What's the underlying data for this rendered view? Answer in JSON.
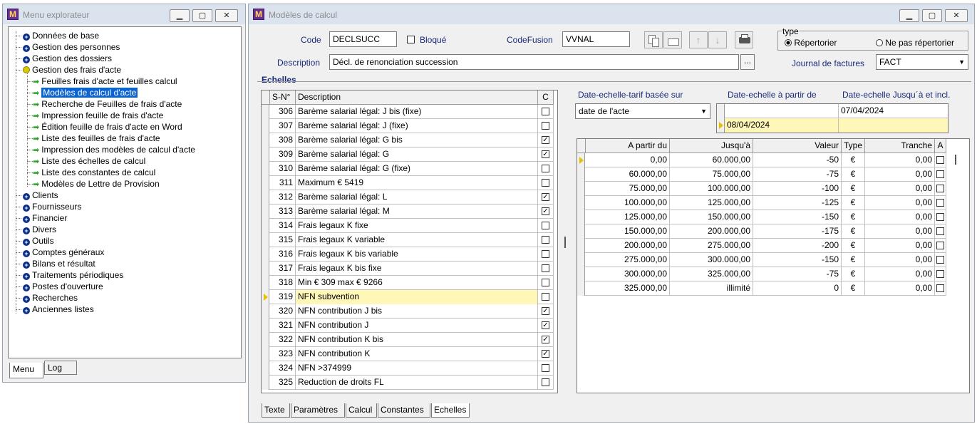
{
  "explorer": {
    "title": "Menu explorateur",
    "tree": [
      {
        "label": "Données de base",
        "type": "plus",
        "level": 0
      },
      {
        "label": "Gestion des personnes",
        "type": "plus",
        "level": 0
      },
      {
        "label": "Gestion des dossiers",
        "type": "plus",
        "level": 0
      },
      {
        "label": "Gestion des frais d'acte",
        "type": "minus",
        "level": 0
      },
      {
        "label": "Feuilles frais d'acte et feuilles calcul",
        "type": "arrow",
        "level": 1
      },
      {
        "label": "Modèles de calcul d'acte",
        "type": "arrow",
        "level": 1,
        "selected": true
      },
      {
        "label": "Recherche de Feuilles de frais d'acte",
        "type": "arrow",
        "level": 1
      },
      {
        "label": "Impression feuille de frais d'acte",
        "type": "arrow",
        "level": 1
      },
      {
        "label": "Édition feuille de frais d'acte en Word",
        "type": "arrow",
        "level": 1
      },
      {
        "label": "Liste des feuilles de frais d'acte",
        "type": "arrow",
        "level": 1
      },
      {
        "label": "Impression des modèles de calcul d'acte",
        "type": "arrow",
        "level": 1
      },
      {
        "label": "Liste des échelles de calcul",
        "type": "arrow",
        "level": 1
      },
      {
        "label": "Liste des constantes de calcul",
        "type": "arrow",
        "level": 1
      },
      {
        "label": "Modèles de Lettre de Provision",
        "type": "arrow",
        "level": 1
      },
      {
        "label": "Clients",
        "type": "plus",
        "level": 0
      },
      {
        "label": "Fournisseurs",
        "type": "plus",
        "level": 0
      },
      {
        "label": "Financier",
        "type": "plus",
        "level": 0
      },
      {
        "label": "Divers",
        "type": "plus",
        "level": 0
      },
      {
        "label": "Outils",
        "type": "plus",
        "level": 0
      },
      {
        "label": "Comptes généraux",
        "type": "plus",
        "level": 0
      },
      {
        "label": "Bilans et résultat",
        "type": "plus",
        "level": 0
      },
      {
        "label": "Traitements périodiques",
        "type": "plus",
        "level": 0
      },
      {
        "label": "Postes d'ouverture",
        "type": "plus",
        "level": 0
      },
      {
        "label": "Recherches",
        "type": "plus",
        "level": 0
      },
      {
        "label": "Anciennes listes",
        "type": "plus",
        "level": 0
      }
    ],
    "tabs": [
      "Menu",
      "Log"
    ]
  },
  "main": {
    "title": "Modèles de calcul",
    "code_label": "Code",
    "code_value": "DECLSUCC",
    "bloque_label": "Bloqué",
    "codefusion_label": "CodeFusion",
    "codefusion_value": "VVNAL",
    "description_label": "Description",
    "description_value": "Décl. de renonciation succession",
    "ellipsis": "...",
    "type_group_label": "type",
    "radio_repertorier": "Répertorier",
    "radio_ne_pas": "Ne pas répertorier",
    "journal_label": "Journal de factures",
    "journal_value": "FACT",
    "echelles_label": "Echelles",
    "left_grid": {
      "headers": [
        "S-N°",
        "Description",
        "C"
      ],
      "rows": [
        {
          "sn": "306",
          "desc": "Barème salarial légal: J bis (fixe)",
          "c": false
        },
        {
          "sn": "307",
          "desc": "Barème salarial légal: J (fixe)",
          "c": false
        },
        {
          "sn": "308",
          "desc": "Barème salarial légal: G bis",
          "c": true
        },
        {
          "sn": "309",
          "desc": "Barème salarial légal: G",
          "c": true
        },
        {
          "sn": "310",
          "desc": "Barème salarial légal: G (fixe)",
          "c": false
        },
        {
          "sn": "311",
          "desc": "Maximum € 5419",
          "c": false
        },
        {
          "sn": "312",
          "desc": "Barème salarial légal: L",
          "c": true
        },
        {
          "sn": "313",
          "desc": "Barème salarial légal: M",
          "c": true
        },
        {
          "sn": "314",
          "desc": "Frais legaux K fixe",
          "c": false
        },
        {
          "sn": "315",
          "desc": "Frais legaux K variable",
          "c": false
        },
        {
          "sn": "316",
          "desc": "Frais legaux K bis variable",
          "c": false
        },
        {
          "sn": "317",
          "desc": "Frais legaux K bis fixe",
          "c": false
        },
        {
          "sn": "318",
          "desc": "Min € 309 max € 9266",
          "c": false
        },
        {
          "sn": "319",
          "desc": "NFN subvention",
          "c": false,
          "current": true
        },
        {
          "sn": "320",
          "desc": "NFN contribution J bis",
          "c": true
        },
        {
          "sn": "321",
          "desc": "NFN contribution J",
          "c": true
        },
        {
          "sn": "322",
          "desc": "NFN contribution K bis",
          "c": true
        },
        {
          "sn": "323",
          "desc": "NFN contribution K",
          "c": true
        },
        {
          "sn": "324",
          "desc": "NFN >374999",
          "c": false
        },
        {
          "sn": "325",
          "desc": "Reduction de droits FL",
          "c": false
        }
      ]
    },
    "date_tarif_label": "Date-echelle-tarif basée sur",
    "date_tarif_value": "date de l'acte",
    "date_from_label": "Date-echelle à partir de",
    "date_to_label": "Date-echelle Jusqu´à et incl.",
    "date_rows": [
      {
        "from": "",
        "to": "07/04/2024"
      },
      {
        "from": "08/04/2024",
        "to": "",
        "current": true
      }
    ],
    "right_grid": {
      "headers": [
        "A partir du",
        "Jusqu'à",
        "Valeur",
        "Type",
        "Tranche",
        "A"
      ],
      "rows": [
        {
          "from": "0,00",
          "to": "60.000,00",
          "val": "-50",
          "type": "€",
          "tranche": "0,00",
          "current": true
        },
        {
          "from": "60.000,00",
          "to": "75.000,00",
          "val": "-75",
          "type": "€",
          "tranche": "0,00"
        },
        {
          "from": "75.000,00",
          "to": "100.000,00",
          "val": "-100",
          "type": "€",
          "tranche": "0,00"
        },
        {
          "from": "100.000,00",
          "to": "125.000,00",
          "val": "-125",
          "type": "€",
          "tranche": "0,00"
        },
        {
          "from": "125.000,00",
          "to": "150.000,00",
          "val": "-150",
          "type": "€",
          "tranche": "0,00"
        },
        {
          "from": "150.000,00",
          "to": "200.000,00",
          "val": "-175",
          "type": "€",
          "tranche": "0,00"
        },
        {
          "from": "200.000,00",
          "to": "275.000,00",
          "val": "-200",
          "type": "€",
          "tranche": "0,00"
        },
        {
          "from": "275.000,00",
          "to": "300.000,00",
          "val": "-150",
          "type": "€",
          "tranche": "0,00"
        },
        {
          "from": "300.000,00",
          "to": "325.000,00",
          "val": "-75",
          "type": "€",
          "tranche": "0,00"
        },
        {
          "from": "325.000,00",
          "to": "illimité",
          "val": "0",
          "type": "€",
          "tranche": "0,00"
        }
      ]
    },
    "bottom_tabs": [
      "Texte",
      "Paramètres",
      "Calcul",
      "Constantes",
      "Echelles"
    ]
  },
  "colors": {
    "selection": "#0a64d6",
    "current_row": "#fff7b8",
    "label_blue": "#1a2a7a"
  }
}
